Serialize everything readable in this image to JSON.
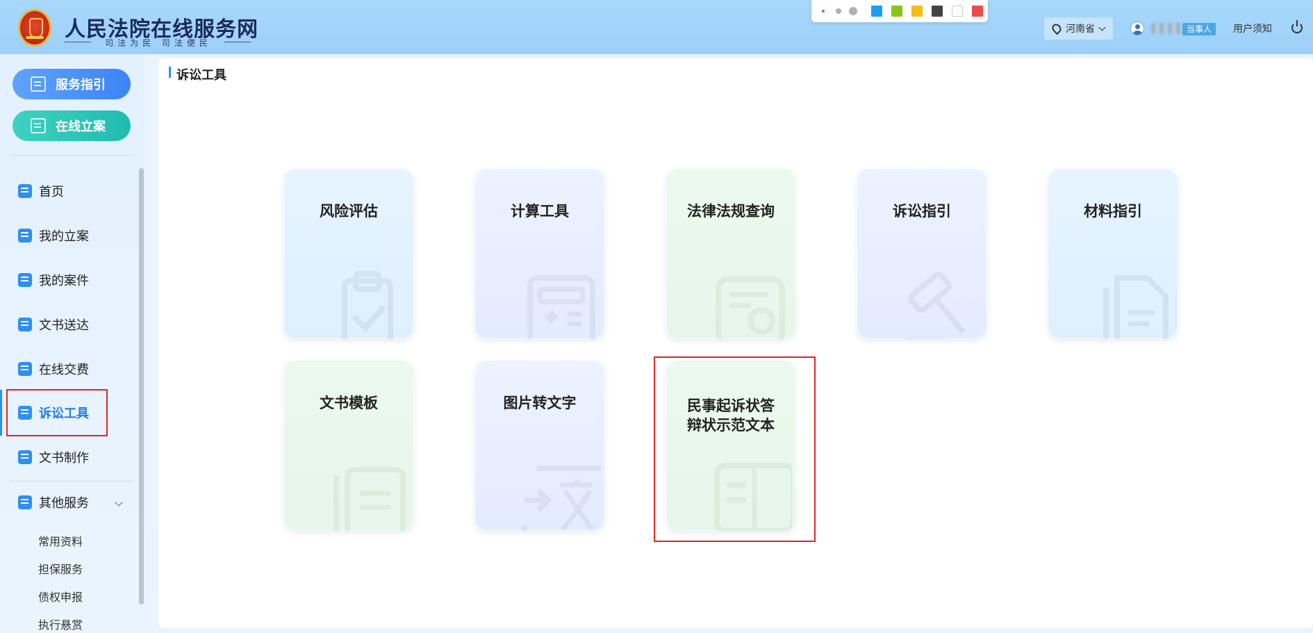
{
  "header": {
    "site_title": "人民法院在线服务网",
    "slogan": "司法为民 司法便民",
    "region": "河南省",
    "user_role": "当事人",
    "notice": "用户须知",
    "toolbar_colors": [
      "#1aa0f0",
      "#8ac41a",
      "#f7bd17",
      "#444444",
      "#ffffff",
      "#ef4b4b"
    ]
  },
  "sidebar": {
    "primary_buttons": [
      "服务指引",
      "在线立案"
    ],
    "nav": [
      {
        "label": "首页",
        "icon": "home-icon"
      },
      {
        "label": "我的立案",
        "icon": "edit-file-icon"
      },
      {
        "label": "我的案件",
        "icon": "clipboard-icon"
      },
      {
        "label": "文书送达",
        "icon": "monitor-icon"
      },
      {
        "label": "在线交费",
        "icon": "payment-icon"
      },
      {
        "label": "诉讼工具",
        "icon": "tools-icon",
        "active": true
      },
      {
        "label": "文书制作",
        "icon": "document-icon"
      },
      {
        "label": "其他服务",
        "icon": "apps-icon",
        "expandable": true
      }
    ],
    "sub_items": [
      "常用资料",
      "担保服务",
      "债权申报",
      "执行悬赏"
    ]
  },
  "main": {
    "title": "诉讼工具",
    "cards": [
      {
        "label": "风险评估",
        "icon": "clipboard-check-icon",
        "theme": "blue"
      },
      {
        "label": "计算工具",
        "icon": "calculator-icon",
        "theme": "lav"
      },
      {
        "label": "法律法规查询",
        "icon": "search-doc-icon",
        "theme": "green"
      },
      {
        "label": "诉讼指引",
        "icon": "gavel-icon",
        "theme": "lav"
      },
      {
        "label": "材料指引",
        "icon": "documents-icon",
        "theme": "blue"
      },
      {
        "label": "文书模板",
        "icon": "template-icon",
        "theme": "green"
      },
      {
        "label": "图片转文字",
        "icon": "image-to-text-icon",
        "theme": "lav"
      },
      {
        "label": "民事起诉状答辩状示范文本",
        "label_line1": "民事起诉状答",
        "label_line2": "辩状示范文本",
        "icon": "book-icon",
        "theme": "green"
      }
    ]
  }
}
